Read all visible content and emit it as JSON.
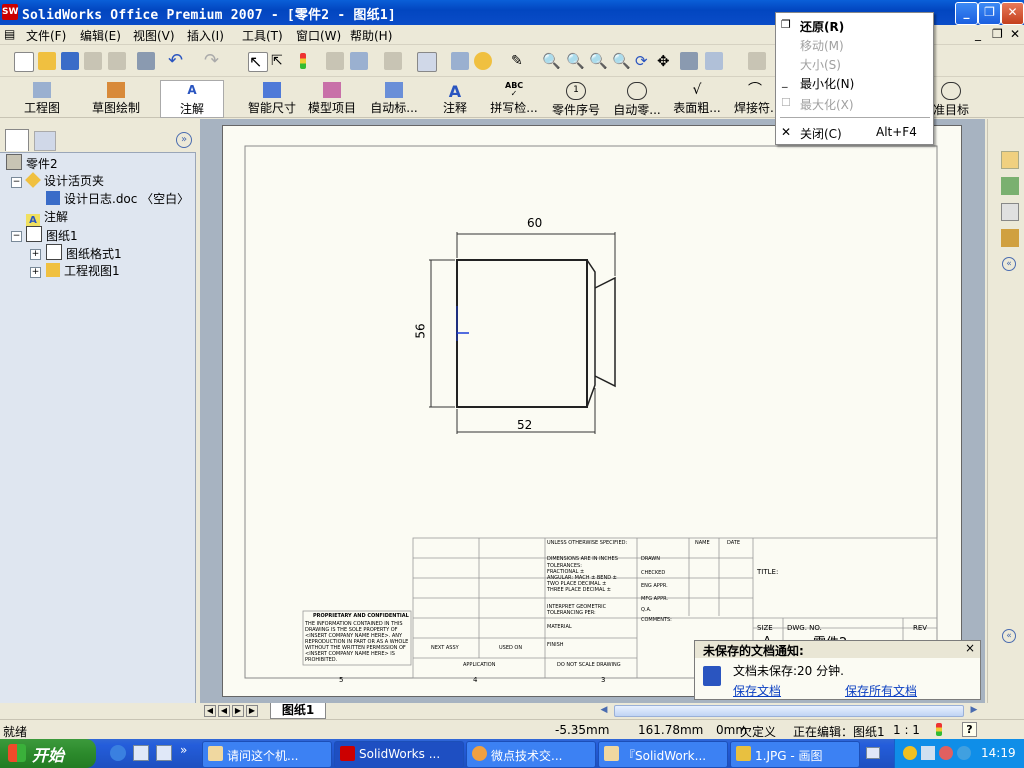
{
  "titlebar": {
    "app_logo": "SW",
    "title": "SolidWorks Office Premium 2007 - [零件2 - 图纸1]"
  },
  "menubar": [
    "文件(F)",
    "编辑(E)",
    "视图(V)",
    "插入(I)",
    "工具(T)",
    "窗口(W)",
    "帮助(H)"
  ],
  "toolbar2": [
    {
      "label": "工程图"
    },
    {
      "label": "草图绘制"
    },
    {
      "label": "注解"
    },
    {
      "label": "智能尺寸"
    },
    {
      "label": "模型项目"
    },
    {
      "label": "自动标..."
    },
    {
      "label": "注释"
    },
    {
      "label": "拼写检..."
    },
    {
      "label": "零件序号"
    },
    {
      "label": "自动零..."
    },
    {
      "label": "表面粗..."
    },
    {
      "label": "焊接符..."
    },
    {
      "label": "准目标"
    }
  ],
  "toolbar2_small": {
    "abc": "ABC",
    "balloon_num": "1"
  },
  "tree": {
    "root": "零件2",
    "items": [
      {
        "label": "设计活页夹"
      },
      {
        "label": "设计日志.doc 〈空白〉"
      },
      {
        "label": "注解"
      },
      {
        "label": "图纸1"
      },
      {
        "label": "图纸格式1"
      },
      {
        "label": "工程视图1"
      }
    ]
  },
  "drawing": {
    "dim_top": "60",
    "dim_left": "56",
    "dim_bottom": "52",
    "title_block": {
      "unless": "UNLESS OTHERWISE SPECIFIED:",
      "name": "NAME",
      "date": "DATE",
      "dimensions": "DIMENSIONS ARE IN INCHES",
      "tolerances": "TOLERANCES:",
      "fractional": "FRACTIONAL ±",
      "angular": "ANGULAR: MACH ±   BEND ±",
      "two_place": "TWO PLACE DECIMAL   ±",
      "three_place": "THREE PLACE DECIMAL   ±",
      "interpret": "INTERPRET GEOMETRIC TOLERANCING PER:",
      "material": "MATERIAL",
      "finish": "FINISH",
      "do_not_scale": "DO NOT SCALE DRAWING",
      "drawn": "DRAWN",
      "checked": "CHECKED",
      "eng_appr": "ENG APPR.",
      "mfg_appr": "MFG APPR.",
      "qa": "Q.A.",
      "comments": "COMMENTS:",
      "title": "TITLE:",
      "size": "SIZE",
      "dwg_no": "DWG. NO.",
      "rev": "REV",
      "size_value": "A",
      "dwg_value": "零件2",
      "next_assy": "NEXT ASSY",
      "used_on": "USED ON",
      "application": "APPLICATION",
      "proprietary_title": "PROPRIETARY AND CONFIDENTIAL",
      "proprietary_text": "THE INFORMATION CONTAINED IN THIS DRAWING IS THE SOLE PROPERTY OF <INSERT COMPANY NAME HERE>. ANY REPRODUCTION IN PART OR AS A WHOLE WITHOUT THE WRITTEN PERMISSION OF <INSERT COMPANY NAME HERE> IS PROHIBITED.",
      "zone5": "5",
      "zone4": "4",
      "zone3": "3"
    }
  },
  "sysmenu": {
    "items": [
      {
        "label": "还原(R)",
        "enabled": true,
        "bold": true
      },
      {
        "label": "移动(M)",
        "enabled": false
      },
      {
        "label": "大小(S)",
        "enabled": false
      },
      {
        "label": "最小化(N)",
        "enabled": true
      },
      {
        "label": "最大化(X)",
        "enabled": false
      },
      {
        "label": "关闭(C)",
        "enabled": true,
        "shortcut": "Alt+F4"
      }
    ]
  },
  "notify": {
    "title": "未保存的文档通知:",
    "message": "文档未保存:20 分钟.",
    "save": "保存文档",
    "save_all": "保存所有文档",
    "close": "×"
  },
  "sheet_tab": "图纸1",
  "status": {
    "ready": "就绪",
    "x": "-5.35mm",
    "y": "161.78mm",
    "z": "0mm",
    "state": "欠定义",
    "editing": "正在编辑：图纸1",
    "scale": "1 : 1",
    "help": "?"
  },
  "taskbar": {
    "start": "开始",
    "more": "»",
    "tasks": [
      {
        "label": "请问这个机..."
      },
      {
        "label": "SolidWorks ..."
      },
      {
        "label": "微点技术交..."
      },
      {
        "label": "『SolidWork..."
      },
      {
        "label": "1.JPG - 画图"
      }
    ],
    "clock": "14:19"
  },
  "colors": {
    "title_blue": "#0a4cc8",
    "sheet_bg": "#fbfbf3",
    "drawing_bg": "#a7b3c1",
    "tree_bg": "#dfe6f0",
    "link": "#0b3fc2"
  }
}
